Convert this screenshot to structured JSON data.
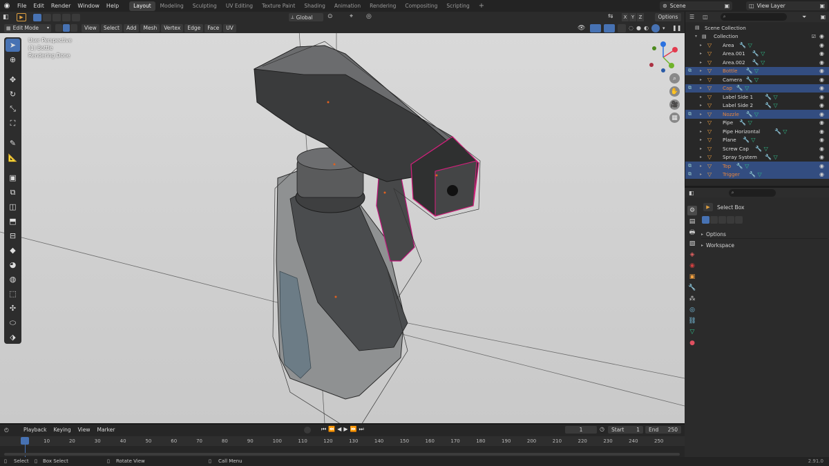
{
  "topbar": {
    "menus": [
      "File",
      "Edit",
      "Render",
      "Window",
      "Help"
    ],
    "workspaces": [
      "Layout",
      "Modeling",
      "Sculpting",
      "UV Editing",
      "Texture Paint",
      "Shading",
      "Animation",
      "Rendering",
      "Compositing",
      "Scripting"
    ],
    "active_workspace": "Layout",
    "add_tab": "+",
    "scene": "Scene",
    "view_layer": "View Layer"
  },
  "viewport_header": {
    "mode": "Edit Mode",
    "menus": [
      "View",
      "Select",
      "Add",
      "Mesh",
      "Vertex",
      "Edge",
      "Face",
      "UV"
    ],
    "transform_orientation": "Global",
    "axes": [
      "X",
      "Y",
      "Z"
    ],
    "options": "Options"
  },
  "viewport": {
    "perspective": "User Perspective",
    "object": "(1) Bottle",
    "status": "Rendering Done"
  },
  "outliner": {
    "root": "Scene Collection",
    "collection": "Collection",
    "items": [
      {
        "name": "Area",
        "selected": false,
        "orange": false
      },
      {
        "name": "Area.001",
        "selected": false,
        "orange": false
      },
      {
        "name": "Area.002",
        "selected": false,
        "orange": false
      },
      {
        "name": "Bottle",
        "selected": true,
        "orange": true
      },
      {
        "name": "Camera",
        "selected": false,
        "orange": false
      },
      {
        "name": "Cap",
        "selected": true,
        "orange": true
      },
      {
        "name": "Label Side 1",
        "selected": false,
        "orange": false
      },
      {
        "name": "Label Side 2",
        "selected": false,
        "orange": false
      },
      {
        "name": "Nozzle",
        "selected": true,
        "orange": true
      },
      {
        "name": "Pipe",
        "selected": false,
        "orange": false
      },
      {
        "name": "Pipe Horizontal",
        "selected": false,
        "orange": false
      },
      {
        "name": "Plane",
        "selected": false,
        "orange": false
      },
      {
        "name": "Screw Cap",
        "selected": false,
        "orange": false
      },
      {
        "name": "Spray System",
        "selected": false,
        "orange": false
      },
      {
        "name": "Top",
        "selected": true,
        "orange": true
      },
      {
        "name": "Trigger",
        "selected": true,
        "orange": true
      }
    ]
  },
  "properties": {
    "tool_name": "Select Box",
    "sections": [
      "Options",
      "Workspace"
    ]
  },
  "timeline": {
    "menus": [
      "Playback",
      "Keying",
      "View",
      "Marker"
    ],
    "current_frame": "1",
    "start_label": "Start",
    "start": "1",
    "end_label": "End",
    "end": "250",
    "ticks": [
      "1",
      "10",
      "20",
      "30",
      "40",
      "50",
      "60",
      "70",
      "80",
      "90",
      "100",
      "110",
      "120",
      "130",
      "140",
      "150",
      "160",
      "170",
      "180",
      "190",
      "200",
      "210",
      "220",
      "230",
      "240",
      "250"
    ]
  },
  "statusbar": {
    "select": "Select",
    "box_select": "Box Select",
    "rotate_view": "Rotate View",
    "call_menu": "Call Menu",
    "version": "2.91.0"
  },
  "colors": {
    "accent": "#4772b3",
    "selection_row": "#334d80",
    "orange_text": "#e6843c",
    "edit_highlight": "#d0207a"
  }
}
